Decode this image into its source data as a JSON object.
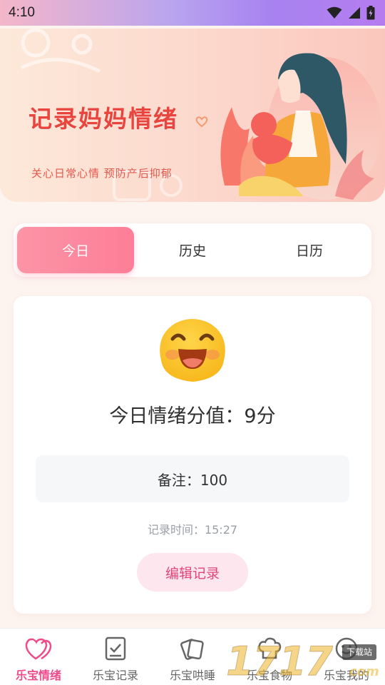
{
  "status_bar": {
    "time": "4:10",
    "icons": [
      "wifi-icon",
      "signal-icon",
      "battery-icon"
    ]
  },
  "banner": {
    "title": "记录妈妈情绪",
    "subtitle": "关心日常心情  预防产后抑郁",
    "title_color": "#e8453f"
  },
  "tabs": [
    {
      "label": "今日",
      "active": true
    },
    {
      "label": "历史",
      "active": false
    },
    {
      "label": "日历",
      "active": false
    }
  ],
  "mood_card": {
    "emoji": "smiling-face-icon",
    "score_text": "今日情绪分值：9分",
    "note_text": "备注：100",
    "record_time_text": "记录时间：15:27",
    "edit_button_label": "编辑记录"
  },
  "bottom_nav": {
    "items": [
      {
        "label": "乐宝情绪",
        "icon": "double-heart-icon",
        "active": true
      },
      {
        "label": "乐宝记录",
        "icon": "checklist-icon",
        "active": false
      },
      {
        "label": "乐宝哄睡",
        "icon": "cards-icon",
        "active": false
      },
      {
        "label": "乐宝食物",
        "icon": "chef-hat-icon",
        "active": false
      },
      {
        "label": "乐宝我的",
        "icon": "profile-icon",
        "active": false
      }
    ]
  },
  "watermark": {
    "main": "1717",
    "badge": "下载站",
    "suffix": "com"
  },
  "colors": {
    "accent": "#fd7e98",
    "active_nav": "#f04b8a",
    "edit_button_text": "#e0457a",
    "edit_button_bg": "#fde6ee"
  }
}
